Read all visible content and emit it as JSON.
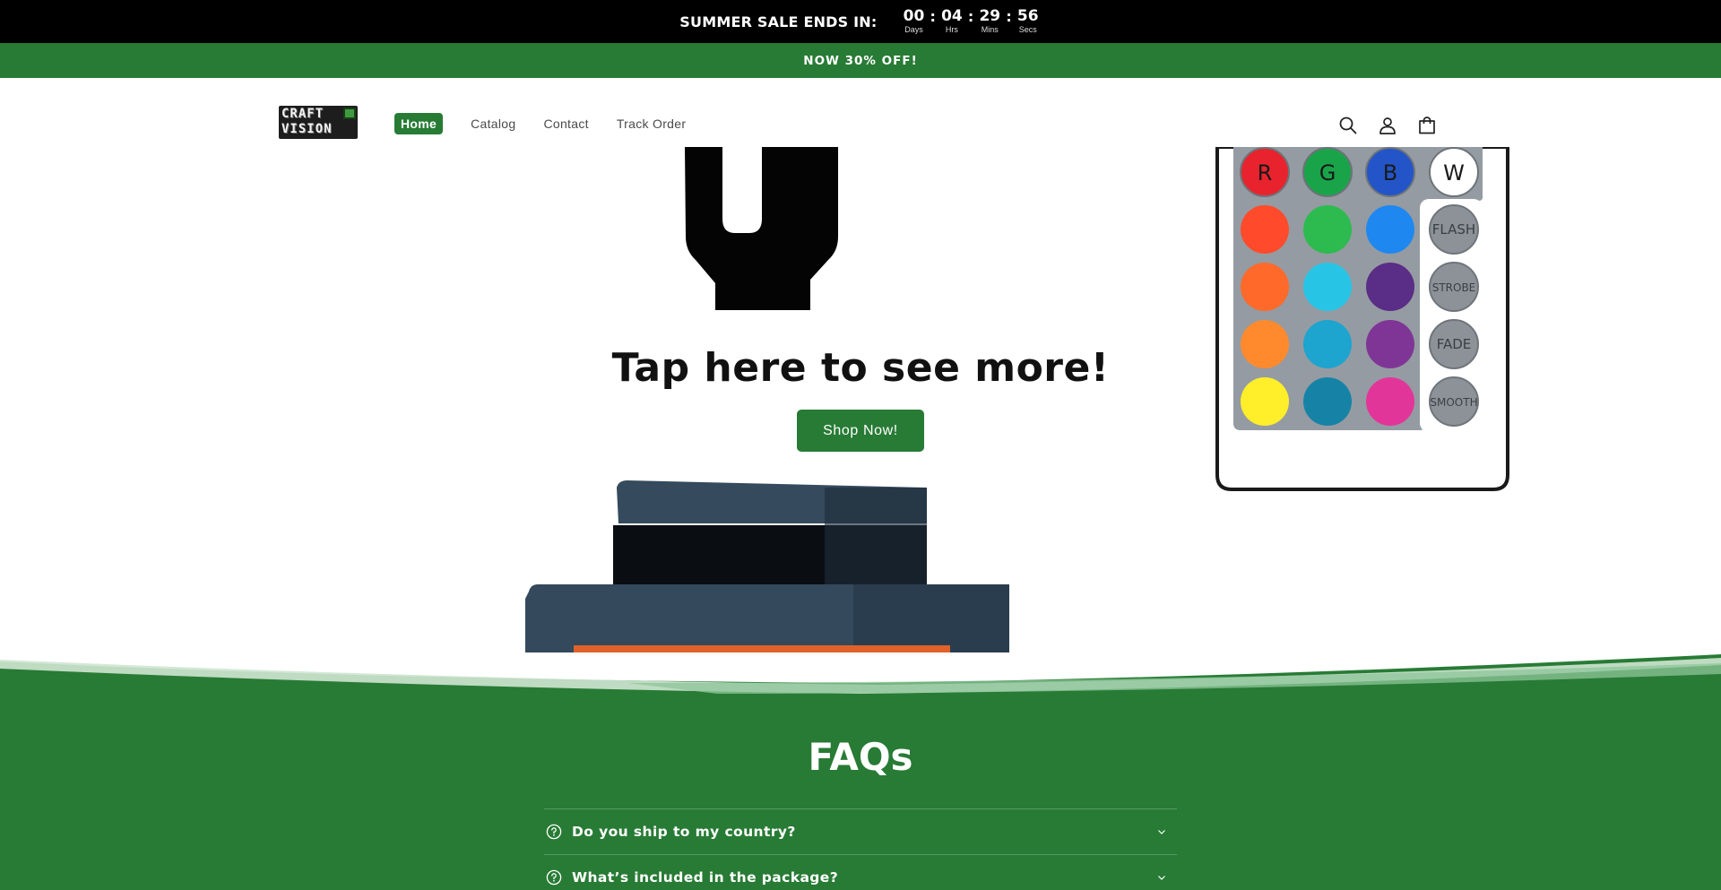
{
  "countdown": {
    "label": "SUMMER SALE ENDS IN:",
    "units": [
      {
        "value": "00",
        "caption": "Days"
      },
      {
        "value": "04",
        "caption": "Hrs"
      },
      {
        "value": "29",
        "caption": "Mins"
      },
      {
        "value": "56",
        "caption": "Secs"
      }
    ]
  },
  "announcement": {
    "text": "NOW 30% OFF!"
  },
  "header": {
    "logo": {
      "line1": "CRAFT",
      "line2": "VISION"
    },
    "nav": [
      {
        "label": "Home",
        "active": true
      },
      {
        "label": "Catalog"
      },
      {
        "label": "Contact"
      },
      {
        "label": "Track Order"
      }
    ],
    "icons": [
      "search-icon",
      "account-icon",
      "cart-icon"
    ]
  },
  "hero": {
    "title": "Tap here to see more!",
    "button_label": "Shop Now!",
    "remote_buttons": {
      "top_row": [
        "R",
        "G",
        "B",
        "W"
      ],
      "side": [
        "FLASH",
        "STROBE",
        "FADE",
        "SMOOTH"
      ]
    },
    "colors": {
      "red": "#e8232d",
      "green": "#1aa44a",
      "blue": "#2355c8",
      "white": "#ffffff",
      "grid": [
        "#ff4b2b",
        "#2dbb4f",
        "#1e88f0",
        "#ff6a2a",
        "#27c4e6",
        "#5a2d86",
        "#ff8a2e",
        "#1da4cf",
        "#7f3596",
        "#ffee2a",
        "#1683a6",
        "#e2359a"
      ]
    }
  },
  "faq": {
    "title": "FAQs",
    "items": [
      {
        "question": "Do you ship to my country?"
      },
      {
        "question": "What’s included in the package?"
      }
    ]
  },
  "theme": {
    "accent": "#287b35",
    "topbar": "#000000"
  }
}
